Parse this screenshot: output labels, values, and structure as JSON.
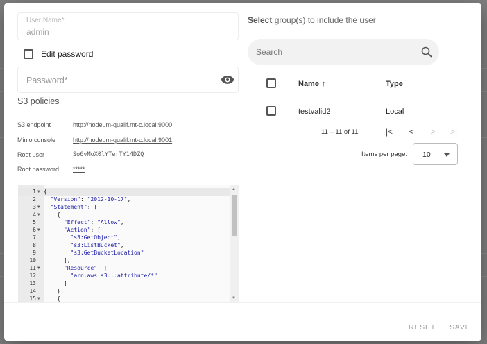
{
  "user_form": {
    "username_label": "User Name*",
    "username_value": "admin",
    "edit_password_label": "Edit password",
    "password_placeholder": "Password*"
  },
  "s3": {
    "title": "S3 policies",
    "rows": [
      {
        "key": "S3 endpoint",
        "value": "http://nodeum-qualif.mt-c.local:9000"
      },
      {
        "key": "Minio console",
        "value": "http://nodeum-qualif.mt-c.local:9001"
      },
      {
        "key": "Root user",
        "value": "So6vMoX0lYTerTY14DZQ"
      },
      {
        "key": "Root password",
        "value": "*****"
      }
    ]
  },
  "policy_editor": {
    "lines": [
      {
        "n": "1",
        "fold": true,
        "text": "{"
      },
      {
        "n": "2",
        "fold": false,
        "text": "  \"Version\": \"2012-10-17\","
      },
      {
        "n": "3",
        "fold": true,
        "text": "  \"Statement\": ["
      },
      {
        "n": "4",
        "fold": true,
        "text": "    {"
      },
      {
        "n": "5",
        "fold": false,
        "text": "      \"Effect\": \"Allow\","
      },
      {
        "n": "6",
        "fold": true,
        "text": "      \"Action\": ["
      },
      {
        "n": "7",
        "fold": false,
        "text": "        \"s3:GetObject\","
      },
      {
        "n": "8",
        "fold": false,
        "text": "        \"s3:ListBucket\","
      },
      {
        "n": "9",
        "fold": false,
        "text": "        \"s3:GetBucketLocation\""
      },
      {
        "n": "10",
        "fold": false,
        "text": "      ],"
      },
      {
        "n": "11",
        "fold": true,
        "text": "      \"Resource\": ["
      },
      {
        "n": "12",
        "fold": false,
        "text": "        \"arn:aws:s3:::attribute/*\""
      },
      {
        "n": "13",
        "fold": false,
        "text": "      ]"
      },
      {
        "n": "14",
        "fold": false,
        "text": "    },"
      },
      {
        "n": "15",
        "fold": true,
        "text": "    {"
      }
    ]
  },
  "groups": {
    "title_bold": "Select",
    "title_rest": " group(s) to include the user",
    "search_placeholder": "Search",
    "columns": {
      "name": "Name",
      "type": "Type"
    },
    "rows": [
      {
        "name": "testvalid2",
        "type": "Local"
      }
    ],
    "pagination": {
      "range": "11 – 11 of 11",
      "items_per_page_label": "Items per page:",
      "items_per_page": "10"
    }
  },
  "footer": {
    "reset_label": "RESET",
    "save_label": "SAVE"
  },
  "icons": {
    "eye": "eye-icon",
    "search": "search-icon",
    "sort": "arrow-up-icon",
    "first": "first-page-icon",
    "prev": "chevron-left-icon",
    "next": "chevron-right-icon",
    "last": "last-page-icon",
    "caret": "caret-down-icon"
  },
  "colors": {
    "accent_text": "#555555",
    "disabled_text": "#a0a0a0",
    "json_string": "#1a1aa6"
  }
}
